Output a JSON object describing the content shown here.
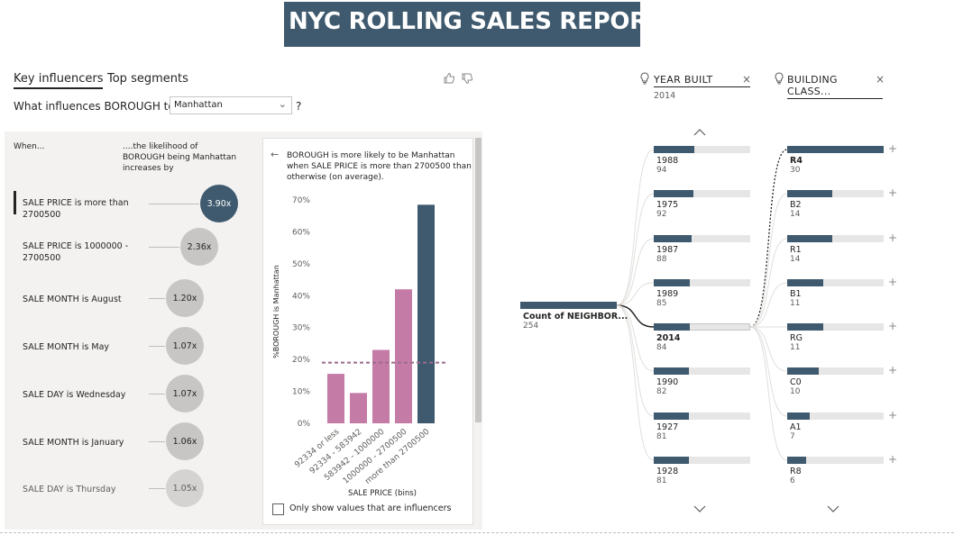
{
  "report": {
    "title": "NYC ROLLING SALES REPORT"
  },
  "key_influencers": {
    "tabs": [
      "Key influencers",
      "Top segments"
    ],
    "question_prefix": "What influences BOROUGH to be",
    "selected_value": "Manhattan",
    "question_suffix": "?",
    "header_when": "When...",
    "header_likelihood": "....the likelihood of BOROUGH being Manhattan increases by",
    "influencers": [
      {
        "label": "SALE PRICE is more than 2700500",
        "value": "3.90x",
        "selected": true
      },
      {
        "label": "SALE PRICE is 1000000 - 2700500",
        "value": "2.36x",
        "selected": false
      },
      {
        "label": "SALE MONTH is August",
        "value": "1.20x",
        "selected": false
      },
      {
        "label": "SALE MONTH is May",
        "value": "1.07x",
        "selected": false
      },
      {
        "label": "SALE DAY is Wednesday",
        "value": "1.07x",
        "selected": false
      },
      {
        "label": "SALE MONTH is January",
        "value": "1.06x",
        "selected": false
      },
      {
        "label": "SALE DAY is Thursday",
        "value": "1.05x",
        "selected": false
      }
    ],
    "detail_text": "BOROUGH is more likely to be Manhattan when SALE PRICE is more than 2700500 than otherwise (on average).",
    "checkbox_label": "Only show values that are influencers",
    "colors": {
      "highlight": "#3f5a6e",
      "bar": "#c47ba6",
      "average": "#9c6b8e"
    }
  },
  "chart_data": {
    "type": "bar",
    "categories": [
      "92334 or less",
      "92334 - 583942",
      "583942 - 1000000",
      "1000000 - 2700500",
      "more than 2700500"
    ],
    "values": [
      15.5,
      9.5,
      23,
      42,
      68.5
    ],
    "highlight_index": 4,
    "average_line": 19,
    "xlabel": "SALE PRICE (bins)",
    "ylabel": "%BOROUGH is Manhattan",
    "yticks": [
      "0%",
      "10%",
      "20%",
      "30%",
      "40%",
      "50%",
      "60%",
      "70%"
    ],
    "ylim": [
      0,
      70
    ]
  },
  "decomposition": {
    "root": {
      "label": "Count of NEIGHBOR...",
      "value": "254"
    },
    "year_built": {
      "title": "YEAR BUILT",
      "selected": "2014",
      "nodes": [
        {
          "label": "1988",
          "value": "94",
          "fraction": 1.0
        },
        {
          "label": "1975",
          "value": "92",
          "fraction": 0.98
        },
        {
          "label": "1987",
          "value": "88",
          "fraction": 0.94
        },
        {
          "label": "1989",
          "value": "85",
          "fraction": 0.9
        },
        {
          "label": "2014",
          "value": "84",
          "fraction": 0.89,
          "bold": true
        },
        {
          "label": "1990",
          "value": "82",
          "fraction": 0.87
        },
        {
          "label": "1927",
          "value": "81",
          "fraction": 0.86
        },
        {
          "label": "1928",
          "value": "81",
          "fraction": 0.86
        }
      ]
    },
    "building_class": {
      "title": "BUILDING CLASS...",
      "nodes": [
        {
          "label": "R4",
          "value": "30",
          "fraction": 1.0,
          "bold": true
        },
        {
          "label": "B2",
          "value": "14",
          "fraction": 0.47
        },
        {
          "label": "R1",
          "value": "14",
          "fraction": 0.47
        },
        {
          "label": "B1",
          "value": "11",
          "fraction": 0.37
        },
        {
          "label": "RG",
          "value": "11",
          "fraction": 0.37
        },
        {
          "label": "C0",
          "value": "10",
          "fraction": 0.33
        },
        {
          "label": "A1",
          "value": "7",
          "fraction": 0.23
        },
        {
          "label": "R8",
          "value": "6",
          "fraction": 0.2
        }
      ]
    }
  }
}
